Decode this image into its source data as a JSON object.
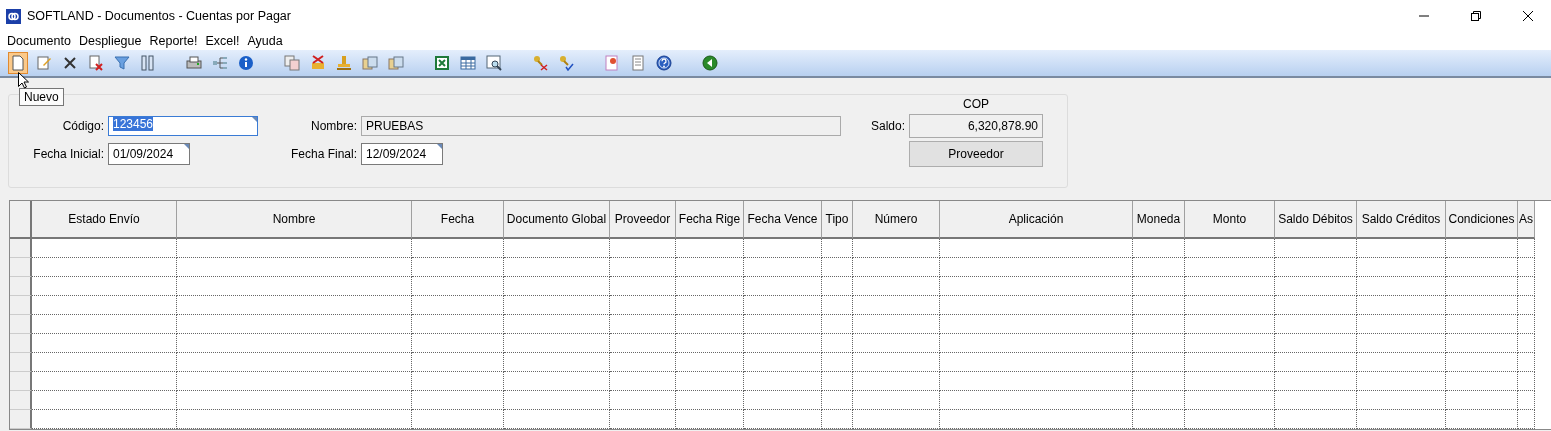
{
  "window": {
    "title": "SOFTLAND - Documentos - Cuentas por Pagar"
  },
  "menu": [
    "Documento",
    "Despliegue",
    "Reporte!",
    "Excel!",
    "Ayuda"
  ],
  "toolbar": [
    [
      {
        "kind": "new",
        "selected": true
      },
      {
        "kind": "edit",
        "selected": false
      },
      {
        "kind": "delete",
        "selected": false
      },
      {
        "kind": "delete-doc",
        "selected": false
      },
      {
        "kind": "filter",
        "selected": false
      },
      {
        "kind": "columns",
        "selected": false
      }
    ],
    [
      {
        "kind": "print",
        "selected": false
      },
      {
        "kind": "tree",
        "selected": false
      },
      {
        "kind": "info",
        "selected": false
      }
    ],
    [
      {
        "kind": "copy",
        "selected": false
      },
      {
        "kind": "cancel-doc",
        "selected": false
      },
      {
        "kind": "stamp",
        "selected": false
      },
      {
        "kind": "docs",
        "selected": false
      },
      {
        "kind": "docs",
        "selected": false
      }
    ],
    [
      {
        "kind": "excel",
        "selected": false
      },
      {
        "kind": "table",
        "selected": false
      },
      {
        "kind": "preview",
        "selected": false
      }
    ],
    [
      {
        "kind": "keys-x",
        "selected": false
      },
      {
        "kind": "keys-check",
        "selected": false
      }
    ],
    [
      {
        "kind": "report",
        "selected": false
      },
      {
        "kind": "page",
        "selected": false
      },
      {
        "kind": "help",
        "selected": false
      }
    ],
    [
      {
        "kind": "back",
        "selected": false
      }
    ]
  ],
  "tooltip": "Nuevo",
  "form": {
    "codigo_label": "Código:",
    "codigo": "123456",
    "nombre_label": "Nombre:",
    "nombre": "PRUEBAS",
    "currency": "COP",
    "saldo_label": "Saldo:",
    "saldo": "6,320,878.90",
    "fecha_inicial_label": "Fecha Inicial:",
    "fecha_inicial": "01/09/2024",
    "fecha_final_label": "Fecha Final:",
    "fecha_final": "12/09/2024",
    "proveedor_button": "Proveedor"
  },
  "table": {
    "columns": [
      "Estado Envío",
      "Nombre",
      "Fecha",
      "Documento Global",
      "Proveedor",
      "Fecha Rige",
      "Fecha Vence",
      "Tipo",
      "Número",
      "Aplicación",
      "Moneda",
      "Monto",
      "Saldo Débitos",
      "Saldo Créditos",
      "Condiciones",
      "As"
    ]
  }
}
